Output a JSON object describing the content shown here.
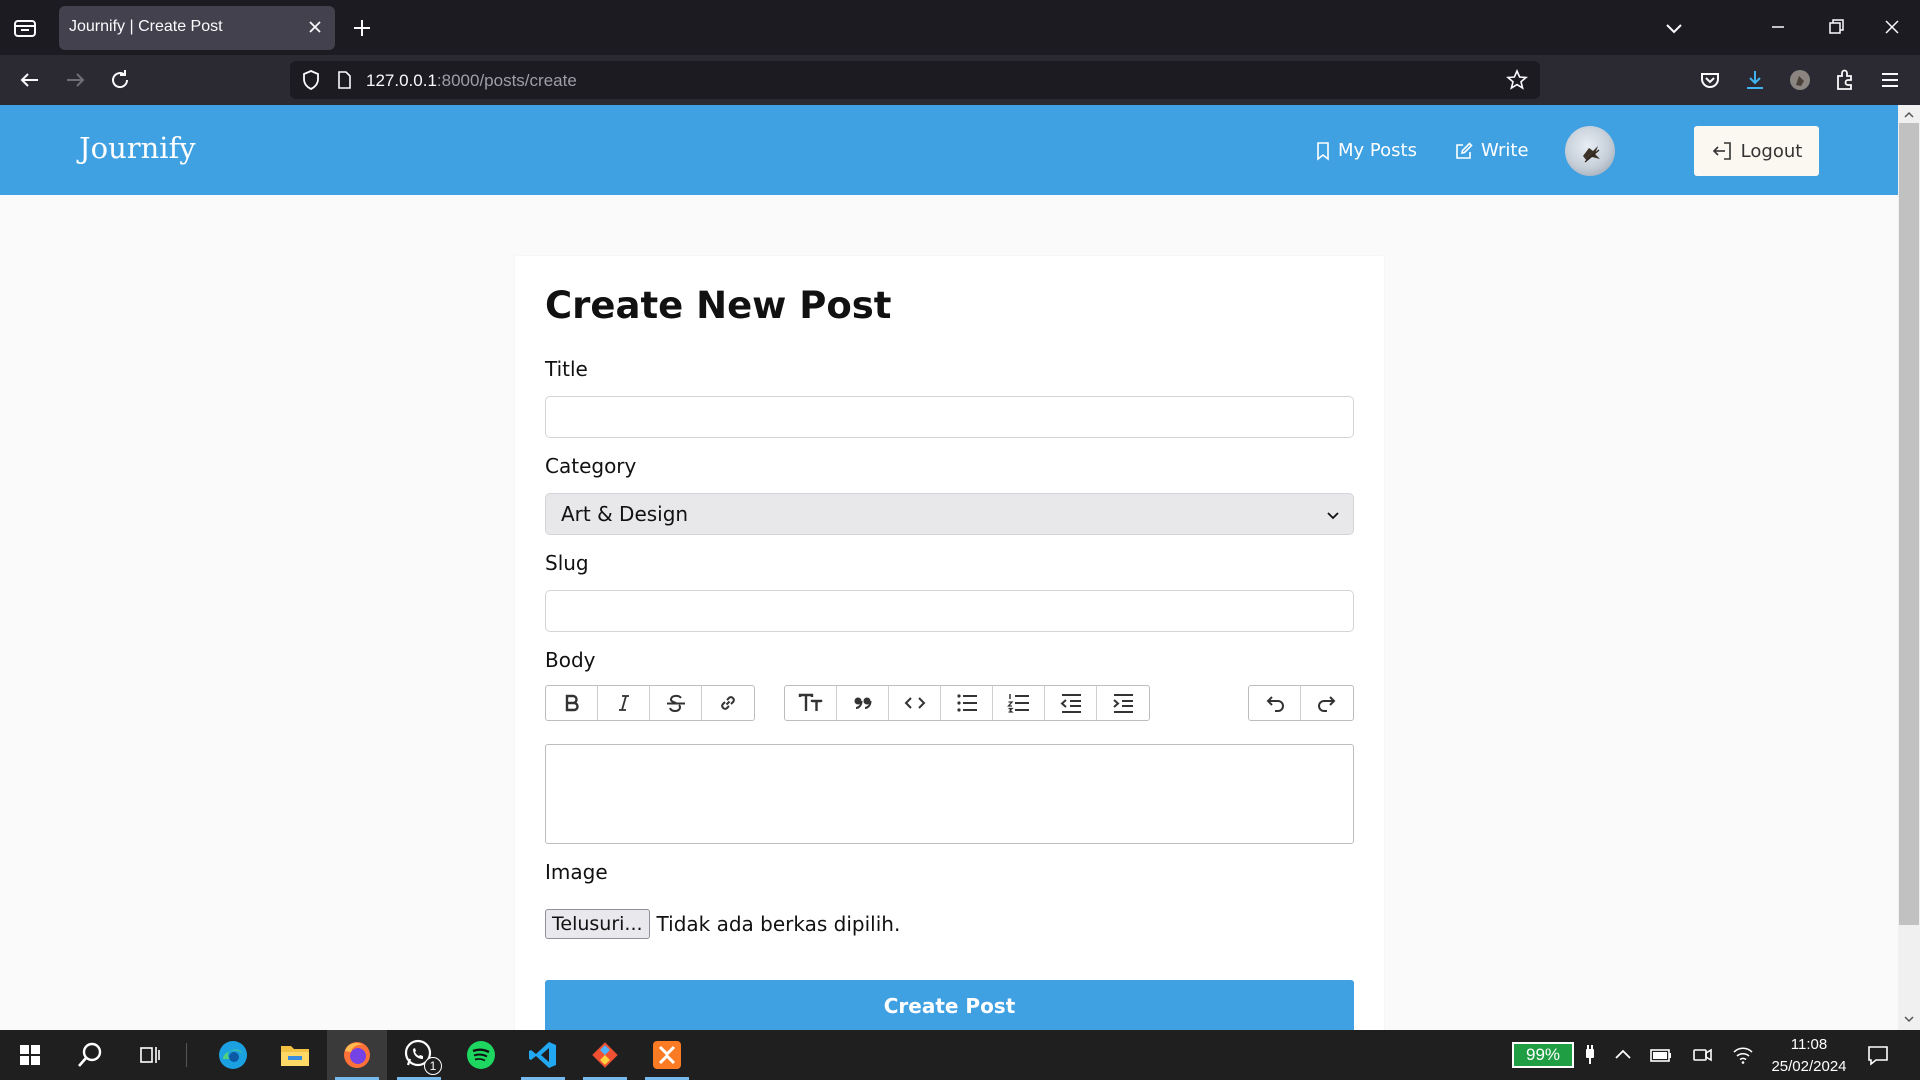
{
  "browser": {
    "tab_title": "Journify | Create Post",
    "url_host": "127.0.0.1",
    "url_path": ":8000/posts/create"
  },
  "site": {
    "brand": "Journify",
    "nav": {
      "my_posts": "My Posts",
      "write": "Write",
      "logout": "Logout"
    }
  },
  "form": {
    "heading": "Create New Post",
    "title_label": "Title",
    "title_value": "",
    "category_label": "Category",
    "category_selected": "Art & Design",
    "slug_label": "Slug",
    "slug_value": "",
    "body_label": "Body",
    "body_value": "",
    "toolbar": {
      "group1": [
        "bold-icon",
        "italic-icon",
        "strikethrough-icon",
        "link-icon"
      ],
      "group2": [
        "heading-icon",
        "quote-icon",
        "code-icon",
        "bullet-list-icon",
        "numbered-list-icon",
        "outdent-icon",
        "indent-icon"
      ],
      "group3": [
        "undo-icon",
        "redo-icon"
      ]
    },
    "image_label": "Image",
    "file_button": "Telusuri...",
    "file_status": "Tidak ada berkas dipilih.",
    "submit": "Create Post"
  },
  "taskbar": {
    "battery": "99%",
    "time": "11:08",
    "date": "25/02/2024",
    "whatsapp_badge": "1",
    "apps": [
      "start-icon",
      "search-icon",
      "task-view-icon",
      "edge-icon",
      "file-explorer-icon",
      "firefox-icon",
      "whatsapp-icon",
      "spotify-icon",
      "vscode-icon",
      "git-icon",
      "xampp-icon"
    ]
  },
  "colors": {
    "header": "#3fa0e2",
    "primary_button": "#3fa0e2",
    "battery": "#1f9e44"
  }
}
